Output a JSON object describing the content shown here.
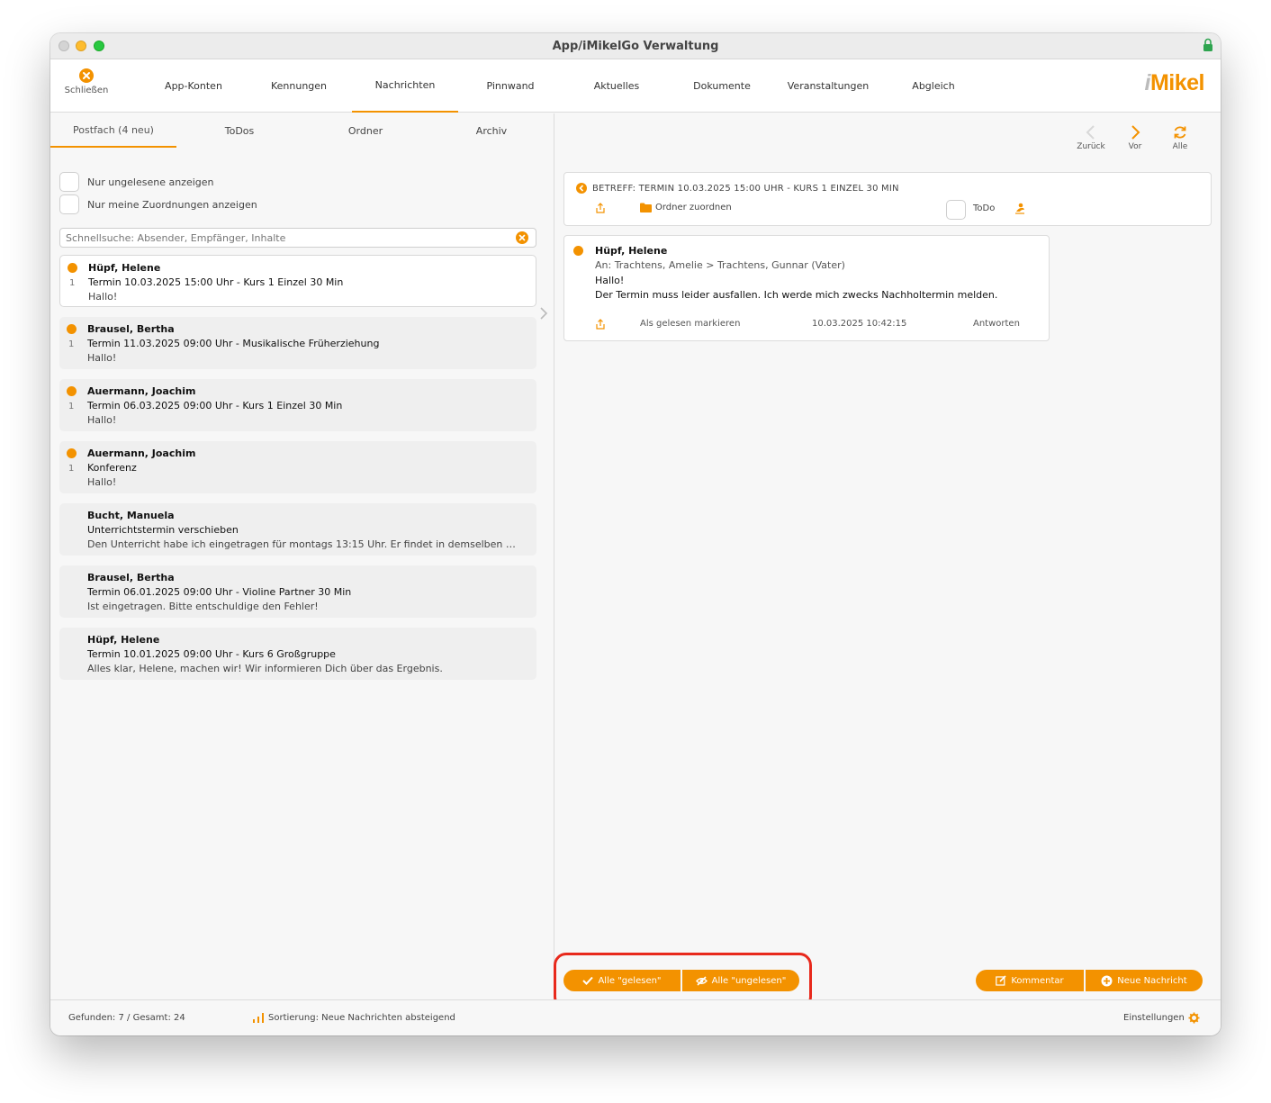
{
  "window": {
    "title": "App/iMikelGo Verwaltung"
  },
  "toolbar": {
    "close_label": "Schließen",
    "tabs": [
      {
        "label": "App-Konten"
      },
      {
        "label": "Kennungen"
      },
      {
        "label": "Nachrichten",
        "active": true
      },
      {
        "label": "Pinnwand"
      },
      {
        "label": "Aktuelles"
      },
      {
        "label": "Dokumente"
      },
      {
        "label": "Veranstaltungen"
      },
      {
        "label": "Abgleich"
      }
    ],
    "logo": {
      "prefix": "i",
      "rest": "Mikel"
    }
  },
  "subtabs": [
    {
      "label": "Postfach (4 neu)",
      "active": true
    },
    {
      "label": "ToDos"
    },
    {
      "label": "Ordner"
    },
    {
      "label": "Archiv"
    }
  ],
  "filters": {
    "unread_only": "Nur ungelesene anzeigen",
    "mine_only": "Nur meine Zuordnungen anzeigen"
  },
  "search": {
    "placeholder": "Schnellsuche: Absender, Empfänger, Inhalte"
  },
  "messages": [
    {
      "sender": "Hüpf, Helene",
      "subject": "Termin 10.03.2025 15:00 Uhr - Kurs 1 Einzel 30 Min",
      "preview": "Hallo!",
      "count": "1",
      "unread": true,
      "selected": true
    },
    {
      "sender": "Brausel, Bertha",
      "subject": "Termin 11.03.2025 09:00 Uhr - Musikalische Früherziehung",
      "preview": "Hallo!",
      "count": "1",
      "unread": true
    },
    {
      "sender": "Auermann, Joachim",
      "subject": "Termin 06.03.2025 09:00 Uhr - Kurs 1 Einzel 30 Min",
      "preview": "Hallo!",
      "count": "1",
      "unread": true
    },
    {
      "sender": "Auermann, Joachim",
      "subject": "Konferenz",
      "preview": "Hallo!",
      "count": "1",
      "unread": true
    },
    {
      "sender": "Bucht, Manuela",
      "subject": "Unterrichtstermin verschieben",
      "preview": "Den Unterricht habe ich eingetragen für montags 13:15 Uhr. Er findet in demselben …",
      "count": "",
      "unread": false
    },
    {
      "sender": "Brausel, Bertha",
      "subject": "Termin 06.01.2025 09:00 Uhr - Violine Partner 30 Min",
      "preview": "Ist eingetragen. Bitte entschuldige den Fehler!",
      "count": "",
      "unread": false
    },
    {
      "sender": "Hüpf, Helene",
      "subject": "Termin 10.01.2025 09:00 Uhr - Kurs 6 Großgruppe",
      "preview": "Alles klar, Helene, machen wir! Wir informieren Dich über das Ergebnis.",
      "count": "",
      "unread": false
    }
  ],
  "navigation": {
    "back": "Zurück",
    "forward": "Vor",
    "all": "Alle"
  },
  "detail": {
    "subject": "BETREFF: TERMIN 10.03.2025 15:00 UHR - KURS 1 EINZEL 30 MIN",
    "assign_folder": "Ordner zuordnen",
    "todo_label": "ToDo",
    "message": {
      "sender": "Hüpf, Helene",
      "to": "An: Trachtens, Amelie > Trachtens, Gunnar (Vater)",
      "body": "Hallo!\nDer Termin muss leider ausfallen. Ich werde mich zwecks Nachholtermin melden.",
      "mark_read": "Als gelesen markieren",
      "timestamp": "10.03.2025 10:42:15",
      "reply": "Antworten"
    }
  },
  "actions": {
    "all_read": "Alle \"gelesen\"",
    "all_unread": "Alle \"ungelesen\"",
    "comment": "Kommentar",
    "new_message": "Neue Nachricht"
  },
  "status": {
    "found": "Gefunden: 7 / Gesamt: 24",
    "sort": "Sortierung: Neue Nachrichten absteigend",
    "settings": "Einstellungen"
  },
  "colors": {
    "accent": "#f39200",
    "highlight": "#e8291c"
  }
}
